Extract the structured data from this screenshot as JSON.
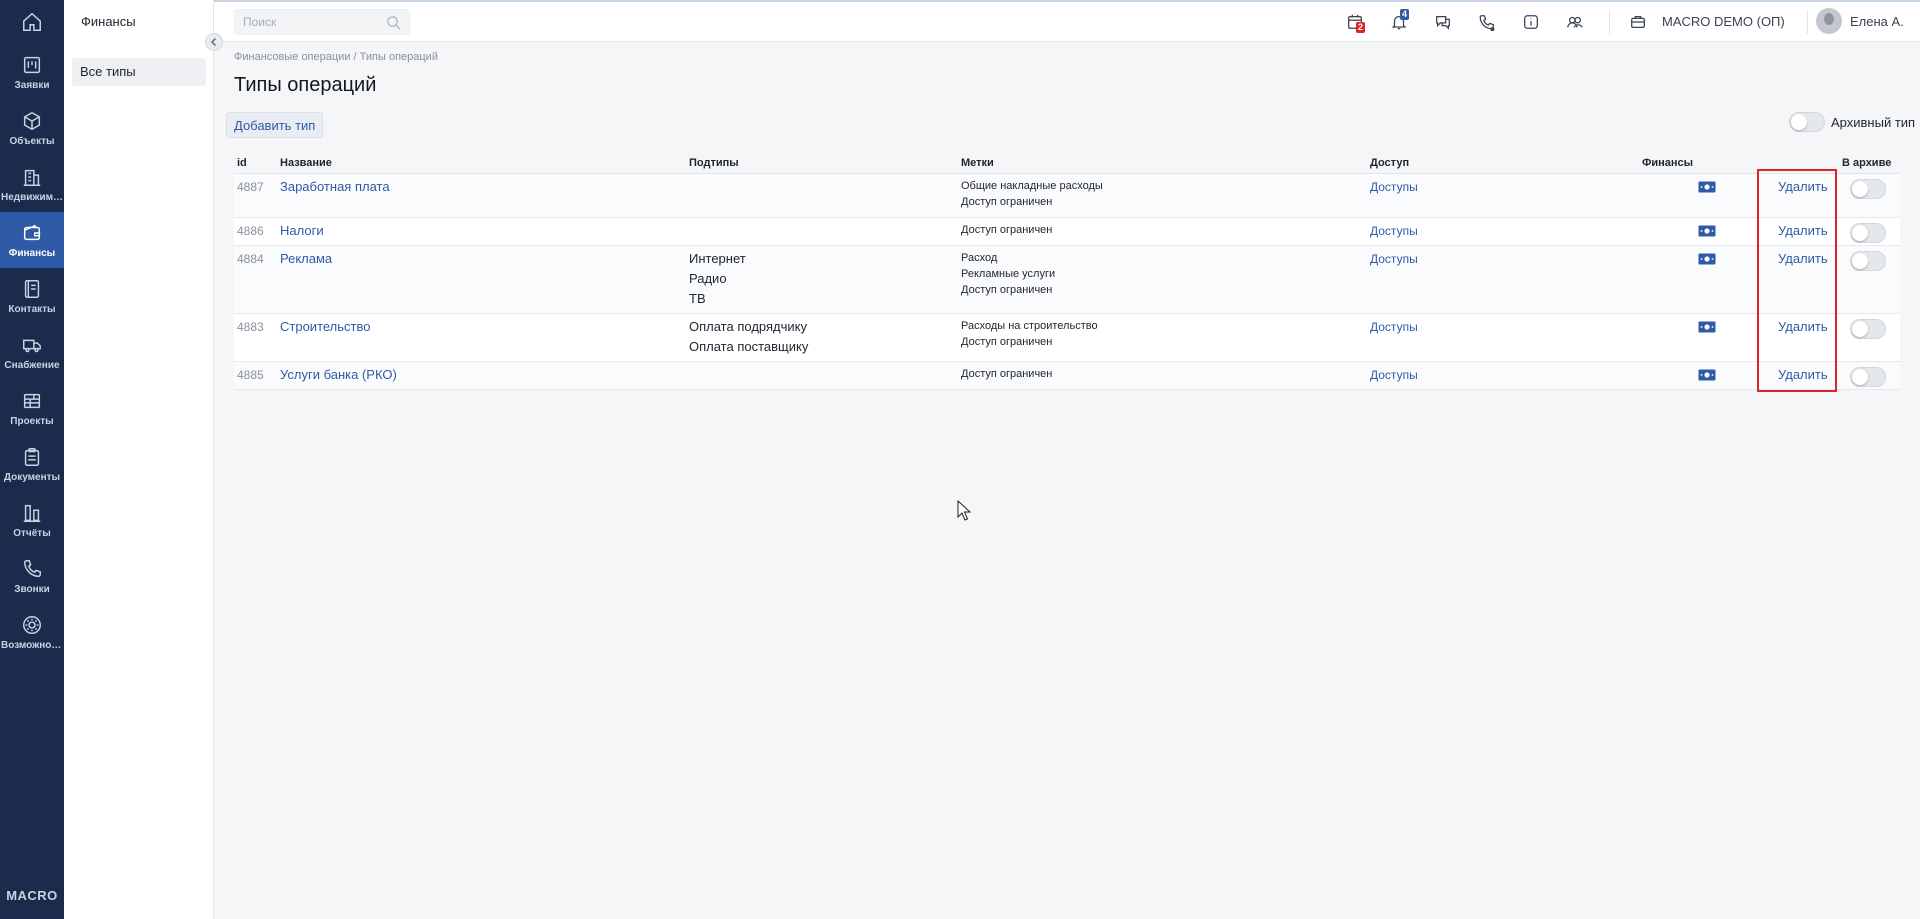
{
  "nav": {
    "items": [
      {
        "label": "Заявки"
      },
      {
        "label": "Объекты"
      },
      {
        "label": "Недвижимость"
      },
      {
        "label": "Финансы"
      },
      {
        "label": "Контакты"
      },
      {
        "label": "Снабжение"
      },
      {
        "label": "Проекты"
      },
      {
        "label": "Документы"
      },
      {
        "label": "Отчёты"
      },
      {
        "label": "Звонки"
      },
      {
        "label": "Возможности"
      }
    ],
    "active": "Финансы",
    "brand": "MACRO"
  },
  "subnav": {
    "title": "Финансы",
    "items": [
      {
        "label": "Все типы"
      }
    ]
  },
  "header": {
    "search_placeholder": "Поиск",
    "calendar_badge": "2",
    "notifications_badge": "4",
    "company": "MACRO DEMO (ОП)",
    "user_name": "Елена А."
  },
  "breadcrumb": {
    "parent": "Финансовые операции",
    "separator": "/",
    "current": "Типы операций"
  },
  "page": {
    "title": "Типы операций",
    "add_button": "Добавить тип",
    "archive_toggle_label": "Архивный тип"
  },
  "table": {
    "columns": {
      "id": "id",
      "name": "Название",
      "subtypes": "Подтипы",
      "tags": "Метки",
      "access": "Доступ",
      "finance": "Финансы",
      "archive": "В архиве"
    },
    "rows": [
      {
        "id": "4887",
        "name": "Заработная плата",
        "subtypes": [],
        "tags": [
          "Общие накладные расходы",
          "Доступ ограничен"
        ],
        "access": "Доступы",
        "delete": "Удалить",
        "archived": false
      },
      {
        "id": "4886",
        "name": "Налоги",
        "subtypes": [],
        "tags": [
          "Доступ ограничен"
        ],
        "access": "Доступы",
        "delete": "Удалить",
        "archived": false
      },
      {
        "id": "4884",
        "name": "Реклама",
        "subtypes": [
          "Интернет",
          "Радио",
          "ТВ"
        ],
        "tags": [
          "Расход",
          "Рекламные услуги",
          "Доступ ограничен"
        ],
        "access": "Доступы",
        "delete": "Удалить",
        "archived": false
      },
      {
        "id": "4883",
        "name": "Строительство",
        "subtypes": [
          "Оплата подрядчику",
          "Оплата поставщику"
        ],
        "tags": [
          "Расходы на строительство",
          "Доступ ограничен"
        ],
        "access": "Доступы",
        "delete": "Удалить",
        "archived": false
      },
      {
        "id": "4885",
        "name": "Услуги банка (РКО)",
        "subtypes": [],
        "tags": [
          "Доступ ограничен"
        ],
        "access": "Доступы",
        "delete": "Удалить",
        "archived": false
      }
    ]
  },
  "colors": {
    "nav_bg": "#1b2b4b",
    "nav_active": "#2f5aa8",
    "link": "#2f5aa8",
    "highlight": "#e2222a",
    "calendar_badge": "#e2222a",
    "notifications_badge": "#2f5aa8"
  },
  "icons": {
    "nav": [
      "home-icon",
      "kanban-icon",
      "cube-icon",
      "building-icon",
      "wallet-icon",
      "contacts-icon",
      "truck-icon",
      "projects-icon",
      "clipboard-icon",
      "reports-icon",
      "phone-icon",
      "gear-icon"
    ],
    "header": [
      "calendar-icon",
      "bell-icon",
      "chat-icon",
      "call-icon",
      "info-icon",
      "users-icon",
      "briefcase-icon"
    ],
    "finance": "money-icon"
  }
}
